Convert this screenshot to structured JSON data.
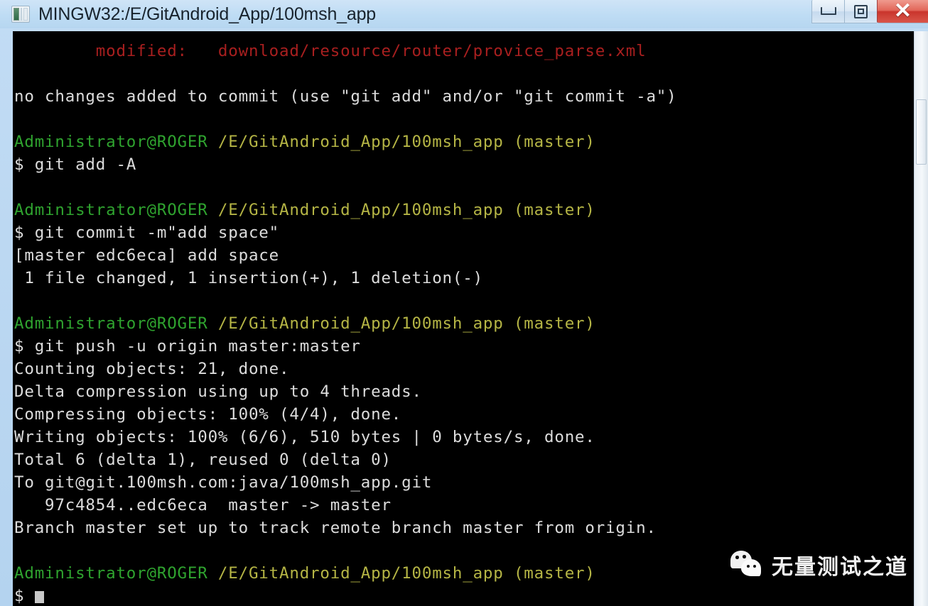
{
  "window": {
    "title": "MINGW32:/E/GitAndroid_App/100msh_app",
    "icon": "terminal-window-icon",
    "controls": {
      "minimize_label": "Minimize",
      "restore_label": "Restore",
      "close_label": "✕"
    },
    "colors": {
      "titlebar": "#bedcf4",
      "close_button": "#c9352c",
      "terminal_background": "#000000"
    }
  },
  "terminal": {
    "colors": {
      "foreground": "#d9d9d9",
      "prompt_user": "#2fa32f",
      "prompt_path": "#b5b545",
      "modified_file": "#a81f1f"
    },
    "cursor": "block-cursor",
    "lines": [
      {
        "segments": [
          {
            "text": "        modified:   download/resource/router/provice_parse.xml",
            "color": "red"
          }
        ]
      },
      {
        "segments": [
          {
            "text": "",
            "color": "white"
          }
        ]
      },
      {
        "segments": [
          {
            "text": "no changes added to commit (use \"git add\" and/or \"git commit -a\")",
            "color": "white"
          }
        ]
      },
      {
        "segments": [
          {
            "text": "",
            "color": "white"
          }
        ]
      },
      {
        "segments": [
          {
            "text": "Administrator@ROGER",
            "color": "green"
          },
          {
            "text": " /E/GitAndroid_App/100msh_app (master)",
            "color": "yellow"
          }
        ]
      },
      {
        "segments": [
          {
            "text": "$ git add -A",
            "color": "white"
          }
        ]
      },
      {
        "segments": [
          {
            "text": "",
            "color": "white"
          }
        ]
      },
      {
        "segments": [
          {
            "text": "Administrator@ROGER",
            "color": "green"
          },
          {
            "text": " /E/GitAndroid_App/100msh_app (master)",
            "color": "yellow"
          }
        ]
      },
      {
        "segments": [
          {
            "text": "$ git commit -m\"add space\"",
            "color": "white"
          }
        ]
      },
      {
        "segments": [
          {
            "text": "[master edc6eca] add space",
            "color": "white"
          }
        ]
      },
      {
        "segments": [
          {
            "text": " 1 file changed, 1 insertion(+), 1 deletion(-)",
            "color": "white"
          }
        ]
      },
      {
        "segments": [
          {
            "text": "",
            "color": "white"
          }
        ]
      },
      {
        "segments": [
          {
            "text": "Administrator@ROGER",
            "color": "green"
          },
          {
            "text": " /E/GitAndroid_App/100msh_app (master)",
            "color": "yellow"
          }
        ]
      },
      {
        "segments": [
          {
            "text": "$ git push -u origin master:master",
            "color": "white"
          }
        ]
      },
      {
        "segments": [
          {
            "text": "Counting objects: 21, done.",
            "color": "white"
          }
        ]
      },
      {
        "segments": [
          {
            "text": "Delta compression using up to 4 threads.",
            "color": "white"
          }
        ]
      },
      {
        "segments": [
          {
            "text": "Compressing objects: 100% (4/4), done.",
            "color": "white"
          }
        ]
      },
      {
        "segments": [
          {
            "text": "Writing objects: 100% (6/6), 510 bytes | 0 bytes/s, done.",
            "color": "white"
          }
        ]
      },
      {
        "segments": [
          {
            "text": "Total 6 (delta 1), reused 0 (delta 0)",
            "color": "white"
          }
        ]
      },
      {
        "segments": [
          {
            "text": "To git@git.100msh.com:java/100msh_app.git",
            "color": "white"
          }
        ]
      },
      {
        "segments": [
          {
            "text": "   97c4854..edc6eca  master -> master",
            "color": "white"
          }
        ]
      },
      {
        "segments": [
          {
            "text": "Branch master set up to track remote branch master from origin.",
            "color": "white"
          }
        ]
      },
      {
        "segments": [
          {
            "text": "",
            "color": "white"
          }
        ]
      },
      {
        "segments": [
          {
            "text": "Administrator@ROGER",
            "color": "green"
          },
          {
            "text": " /E/GitAndroid_App/100msh_app (master)",
            "color": "yellow"
          }
        ]
      },
      {
        "segments": [
          {
            "text": "$ ",
            "color": "white"
          },
          {
            "text": "",
            "color": "cursor"
          }
        ]
      }
    ]
  },
  "scrollbar": {
    "name": "vertical-scrollbar",
    "thumb_name": "scrollbar-thumb"
  },
  "watermark": {
    "icon": "wechat-icon",
    "text": "无量测试之道"
  }
}
